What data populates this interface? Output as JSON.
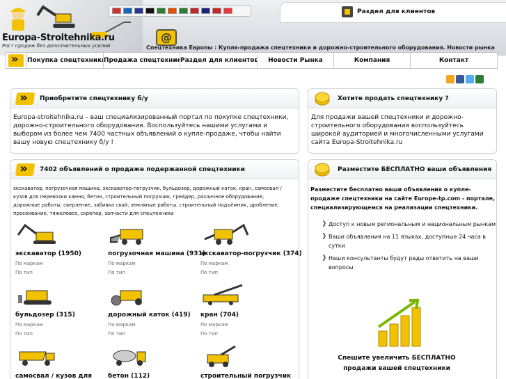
{
  "header": {
    "logo_name": "Europa-Stroitehnika.ru",
    "logo_slogan": "Рост продаж без дополнительных усилий",
    "tagline": "Спецтехника Европы : Купля-продажа спецтехники и дорожно-строительного оборудования. Новости рынка",
    "client_section_label": "Раздел для клиентов",
    "at_symbol": "@",
    "flags": [
      "#d32f2f",
      "#1565c0",
      "#283593",
      "#111111",
      "#2e7d32",
      "#e65100",
      "#2e7d32",
      "#c62828",
      "#1a237e",
      "#c62828",
      "#e53935"
    ]
  },
  "nav": {
    "items": [
      {
        "label": "Покупка спецтехники"
      },
      {
        "label": "Продажа спецтехники"
      },
      {
        "label": "Раздел для клиентов"
      },
      {
        "label": "Новости Рынка"
      },
      {
        "label": "Компания"
      },
      {
        "label": "Контакт"
      }
    ]
  },
  "buy_box": {
    "title": "Приобретите спецтехнику б/у",
    "text": "Europa-stroitehnika.ru – ваш специализированный портал по покупке спецтехники, дорожно-строительного оборудования. Воспользуйтесь нашими услугами и выбором из более чем 7400 частных объявлений о купле-продаже, чтобы найти вашу новую спецтехнику б/у !"
  },
  "sell_box": {
    "title": "Хотите продать спецтехнику ?",
    "text": "Для продажи вашей спецтехники и дорожно-строительного оборудования воспользуйтесь широкой аудиторией и многочисленными услугами сайта Europa-Stroitehnika.ru"
  },
  "listings_box": {
    "title": "7402 объявлений о продаже подержанной спецтехники",
    "categories_text": "экскаватор, погрузочная машина, экскаватор-погрузчик, бульдозер, дорожный каток, кран, самосвал / кузов для перевозки камня, бетон, строительный погрузчик, грейдер, различное оборудование, дорожные работы, сверление, забивка свай, земляные работы, строительный подъёмник, дробление, просеивание, тяжеловоз, скрепер, запчасти для спецтехники",
    "by_brand": "По маркам",
    "by_type": "По тип",
    "machines": [
      {
        "name": "экскаватор (1950)"
      },
      {
        "name": "погрузочная машина (931)"
      },
      {
        "name": "экскаватор-погрузчик (374)"
      },
      {
        "name": "бульдозер (315)"
      },
      {
        "name": "дорожный каток (419)"
      },
      {
        "name": "кран (704)"
      },
      {
        "name": "самосвал / кузов для"
      },
      {
        "name": "бетон (112)"
      },
      {
        "name": "строительный погрузчик"
      }
    ]
  },
  "post_box": {
    "title": "Разместите БЕСПЛАТНО ваши объявления",
    "intro": "Разместите бесплатно ваши объявления о купле-продаже спецтехники на сайте Europe-tp.com - портале, специализирующемся на реализации спецтехники.",
    "bullets": [
      "Доступ к новым региональным и национальным рынкам",
      "Ваши объявления на 11 языках, доступные 24 часа в сутки",
      "Наши консультанты будут рады ответить на ваши вопросы"
    ],
    "cta": "Спешите увеличить БЕСПЛАТНО продажи вашей спецтехники"
  },
  "social": {
    "colors": [
      "#f5a623",
      "#3b5998",
      "#55acee",
      "#2e7d32",
      "#999999"
    ]
  },
  "colors": {
    "accent": "#f2c200",
    "brand_green": "#7ab800"
  }
}
